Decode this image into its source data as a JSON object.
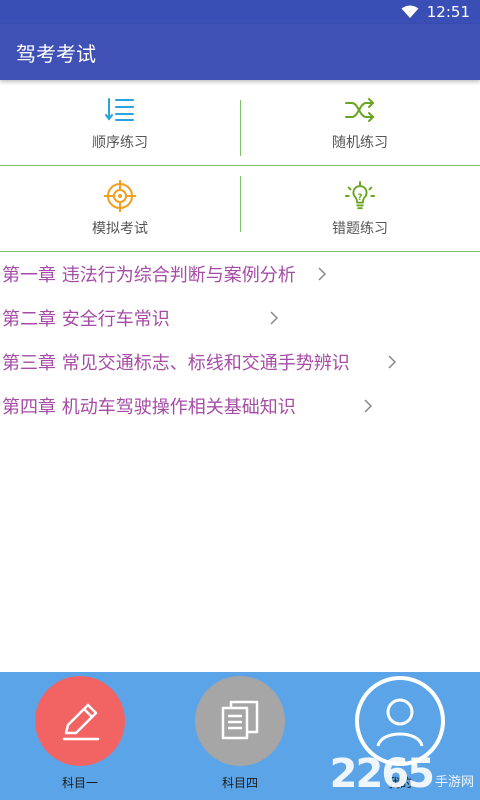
{
  "status_bar": {
    "time": "12:51"
  },
  "app_bar": {
    "title": "驾考考试"
  },
  "grid": {
    "items": [
      {
        "label": "顺序练习",
        "icon": "list-order-icon",
        "color": "#2aa3e0"
      },
      {
        "label": "随机练习",
        "icon": "shuffle-icon",
        "color": "#6aa521"
      },
      {
        "label": "模拟考试",
        "icon": "target-icon",
        "color": "#f0a020"
      },
      {
        "label": "错题练习",
        "icon": "lightbulb-icon",
        "color": "#6aa521"
      }
    ]
  },
  "chapters": [
    {
      "label": "第一章 违法行为综合判断与案例分析"
    },
    {
      "label": "第二章 安全行车常识"
    },
    {
      "label": "第三章 常见交通标志、标线和交通手势辨识"
    },
    {
      "label": "第四章 机动车驾驶操作相关基础知识"
    }
  ],
  "bottom_nav": {
    "tabs": [
      {
        "label": "科目一",
        "icon": "pencil-edit-icon",
        "color": "#f26464"
      },
      {
        "label": "科目四",
        "icon": "documents-icon",
        "color": "#a6a6a6"
      },
      {
        "label": "我的",
        "icon": "user-icon",
        "color": "#5ba4e8"
      }
    ]
  },
  "watermark": {
    "number": "2265",
    "text": "手游网"
  }
}
